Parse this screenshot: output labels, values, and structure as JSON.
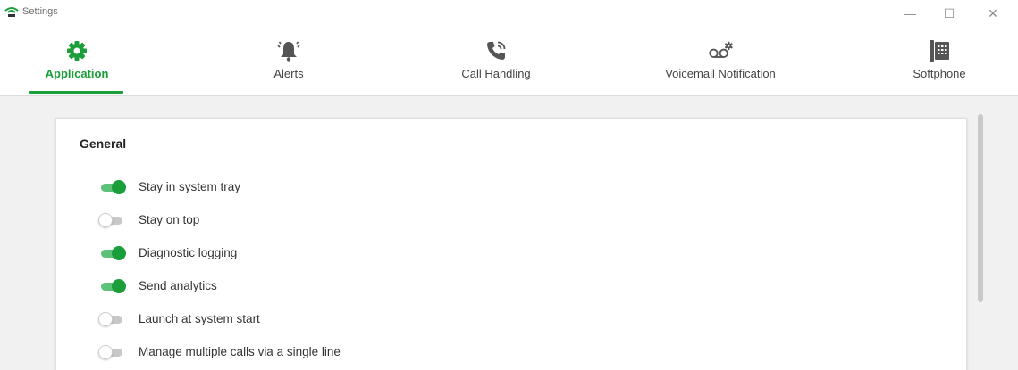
{
  "window": {
    "title": "Settings",
    "minimize_glyph": "—",
    "maximize_glyph": "☐",
    "close_glyph": "✕"
  },
  "colors": {
    "accent": "#1a9e3a",
    "accent_track": "#5cc27a",
    "icon_gray": "#555555",
    "content_bg": "#f1f1f1"
  },
  "tabs": [
    {
      "label": "Application",
      "icon": "gear-icon",
      "active": true
    },
    {
      "label": "Alerts",
      "icon": "bell-icon",
      "active": false
    },
    {
      "label": "Call Handling",
      "icon": "phone-icon",
      "active": false
    },
    {
      "label": "Voicemail Notification",
      "icon": "voicemail-icon",
      "active": false
    },
    {
      "label": "Softphone",
      "icon": "desk-phone-icon",
      "active": false
    }
  ],
  "general": {
    "title": "General",
    "settings": [
      {
        "label": "Stay in system tray",
        "enabled": true
      },
      {
        "label": "Stay on top",
        "enabled": false
      },
      {
        "label": "Diagnostic logging",
        "enabled": true
      },
      {
        "label": "Send analytics",
        "enabled": true
      },
      {
        "label": "Launch at system start",
        "enabled": false
      },
      {
        "label": "Manage multiple calls via a single line",
        "enabled": false
      }
    ]
  }
}
